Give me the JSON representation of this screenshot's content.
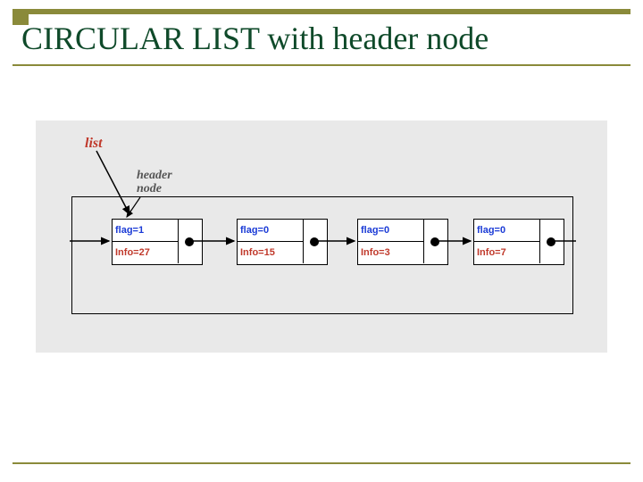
{
  "title": "CIRCULAR LIST with header node",
  "labels": {
    "list": "list",
    "header1": "header",
    "header2": "node"
  },
  "nodes": [
    {
      "flag": "flag=1",
      "info": "Info=27"
    },
    {
      "flag": "flag=0",
      "info": "Info=15"
    },
    {
      "flag": "flag=0",
      "info": "Info=3"
    },
    {
      "flag": "flag=0",
      "info": "Info=7"
    }
  ]
}
